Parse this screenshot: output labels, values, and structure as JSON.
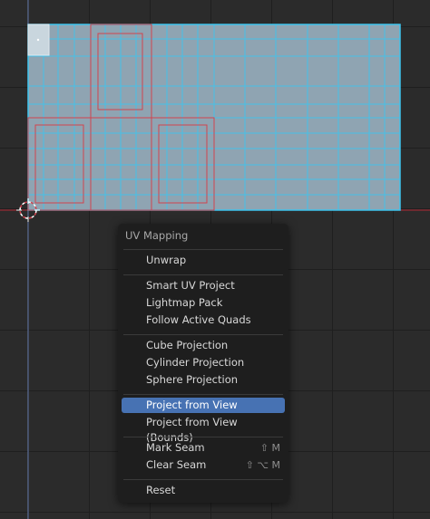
{
  "menu": {
    "title": "UV Mapping",
    "items": [
      {
        "label": "Unwrap",
        "shortcut": ""
      },
      {
        "label": "Smart UV Project",
        "shortcut": ""
      },
      {
        "label": "Lightmap Pack",
        "shortcut": ""
      },
      {
        "label": "Follow Active Quads",
        "shortcut": ""
      },
      {
        "label": "Cube Projection",
        "shortcut": ""
      },
      {
        "label": "Cylinder Projection",
        "shortcut": ""
      },
      {
        "label": "Sphere Projection",
        "shortcut": ""
      },
      {
        "label": "Project from View",
        "shortcut": "",
        "highlighted": true
      },
      {
        "label": "Project from View (Bounds)",
        "shortcut": ""
      },
      {
        "label": "Mark Seam",
        "shortcut": "⇧ M"
      },
      {
        "label": "Clear Seam",
        "shortcut": "⇧ ⌥ M"
      },
      {
        "label": "Reset",
        "shortcut": ""
      }
    ]
  },
  "colors": {
    "background": "#2b2b2b",
    "grid": "#1f1f1f",
    "uv_face_fill": "#8fa4b2",
    "uv_edge": "#3ec5ee",
    "seam": "#d2434e",
    "highlight": "#4772b3",
    "axis_x": "#b02a35",
    "axis_y": "#6a7fb0"
  },
  "icons": {
    "cursor": "2d-cursor-icon"
  }
}
